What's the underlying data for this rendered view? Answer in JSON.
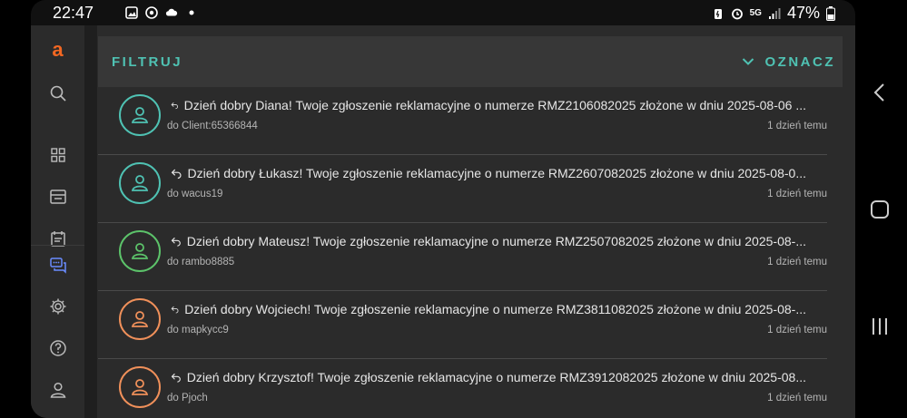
{
  "status_bar": {
    "time": "22:47",
    "network": "5G",
    "battery": "47%",
    "left_icons": [
      "gallery-icon",
      "chrome-icon",
      "cloud-icon",
      "dot-icon"
    ],
    "right_icons": [
      "battery-saver-icon",
      "alarm-icon",
      "signal-icon",
      "battery-icon"
    ]
  },
  "sidebar": {
    "logo": "a",
    "items": [
      "search-icon",
      "dashboard-icon",
      "store-icon",
      "calendar-icon",
      "messages-icon",
      "settings-icon",
      "help-icon",
      "user-icon"
    ]
  },
  "header": {
    "filter_label": "FILTRUJ",
    "mark_label": "OZNACZ"
  },
  "messages": [
    {
      "subject": "Dzień dobry Diana! Twoje zgłoszenie reklamacyjne o numerze RMZ2106082025 złożone w dniu 2025-08-06 ...",
      "recipient": "do Client:65366844",
      "time": "1 dzień temu",
      "avatar_color": "#4fc2b3"
    },
    {
      "subject": "Dzień dobry Łukasz! Twoje zgłoszenie reklamacyjne o numerze RMZ2607082025 złożone w dniu 2025-08-0...",
      "recipient": "do wacus19",
      "time": "1 dzień temu",
      "avatar_color": "#4fc2b3"
    },
    {
      "subject": "Dzień dobry Mateusz! Twoje zgłoszenie reklamacyjne o numerze RMZ2507082025 złożone w dniu 2025-08-...",
      "recipient": "do rambo8885",
      "time": "1 dzień temu",
      "avatar_color": "#5cc36a"
    },
    {
      "subject": "Dzień dobry Wojciech! Twoje zgłoszenie reklamacyjne o numerze RMZ3811082025 złożone w dniu 2025-08-...",
      "recipient": "do mapkycc9",
      "time": "1 dzień temu",
      "avatar_color": "#f0905a"
    },
    {
      "subject": "Dzień dobry Krzysztof! Twoje zgłoszenie reklamacyjne o numerze RMZ3912082025 złożone w dniu 2025-08...",
      "recipient": "do Pjoch",
      "time": "1 dzień temu",
      "avatar_color": "#f0905a"
    }
  ],
  "colors": {
    "accent": "#4fc2b3",
    "brand": "#f26722",
    "active_nav": "#6a8cff"
  }
}
